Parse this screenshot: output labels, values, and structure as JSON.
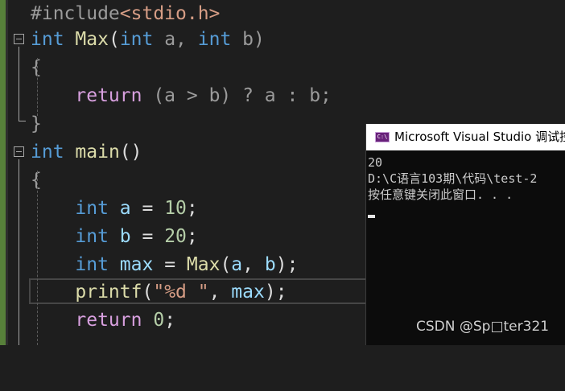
{
  "editor": {
    "lines": [
      {
        "include": "#include",
        "header": "<stdio.h>"
      },
      {
        "type": "int",
        "fname": "Max",
        "open": "(",
        "t1": "int",
        "a": " a, ",
        "t2": "int",
        "b": " b)"
      },
      {
        "text": "{"
      },
      {
        "ret": "return",
        "expr": " (a > b) ? a : b;"
      },
      {
        "text": "}"
      },
      {
        "type": "int",
        "fname": "main",
        "rest": "()"
      },
      {
        "text": "{"
      },
      {
        "type": "int",
        "var": "a",
        "eq": " = ",
        "val": "10",
        "end": ";"
      },
      {
        "type": "int",
        "var": "b",
        "eq": " = ",
        "val": "20",
        "end": ";"
      },
      {
        "type": "int",
        "var": "max",
        "eq": " = ",
        "call": "Max",
        "args_open": "(",
        "arg1": "a",
        "comma": ", ",
        "arg2": "b",
        "args_close": ");"
      },
      {
        "fname": "printf",
        "open": "(",
        "str": "\"%d \"",
        "comma": ", ",
        "arg": "max",
        "close": ");"
      },
      {
        "ret": "return",
        "val": " 0",
        "end": ";"
      }
    ]
  },
  "console": {
    "title": "Microsoft Visual Studio 调试控制台",
    "icon": "console-window-icon",
    "icon_text": "C:\\",
    "output": [
      "20",
      "D:\\C语言103期\\代码\\test-2",
      "按任意键关闭此窗口. . ."
    ]
  },
  "watermark": "CSDN @Sp□ter321",
  "colors": {
    "keyword": "#569cd6",
    "function": "#dcdcaa",
    "variable": "#9cdcfe",
    "control": "#d8a0df",
    "number": "#b5cea8",
    "string": "#d69d85",
    "background": "#1e1e1e",
    "change_bar": "#57803a"
  }
}
